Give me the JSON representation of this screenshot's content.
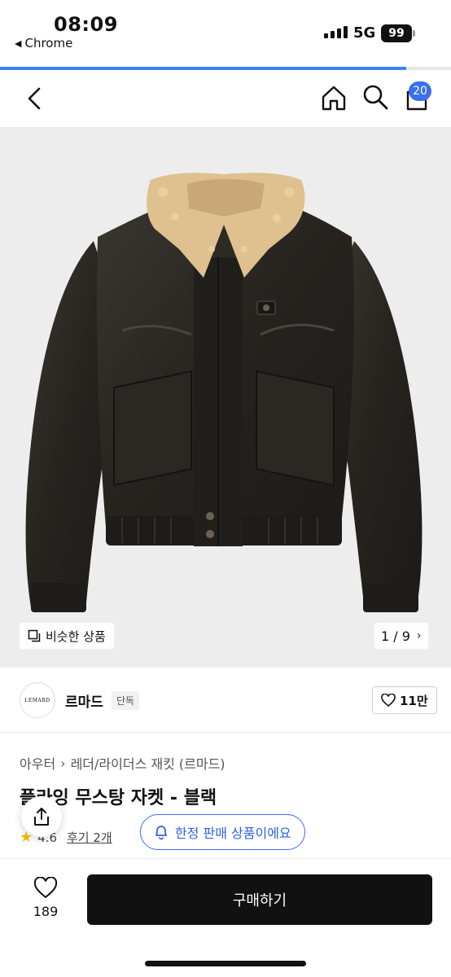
{
  "status_bar": {
    "time": "08:09",
    "back_app": "Chrome",
    "network": "5G",
    "battery": "99"
  },
  "page_load_progress": 0.9,
  "nav": {
    "cart_count": "20"
  },
  "gallery": {
    "similar_label": "비슷한 상품",
    "pager": "1 / 9"
  },
  "brand": {
    "logo_text": "LEMARD",
    "name": "르마드",
    "tag": "단독",
    "likes": "11만"
  },
  "product": {
    "breadcrumb": [
      "아우터",
      "레더/라이더스 재킷 (르마드)"
    ],
    "title": "플라잉 무스탕 자켓 - 블랙",
    "rating": "4.6",
    "reviews": "후기 2개",
    "limited_label": "한정 판매 상품이에요"
  },
  "bottom_bar": {
    "favorite_count": "189",
    "buy_label": "구매하기"
  },
  "colors": {
    "accent": "#3a6ff0",
    "buy_button": "#111111",
    "star": "#f5b800"
  }
}
